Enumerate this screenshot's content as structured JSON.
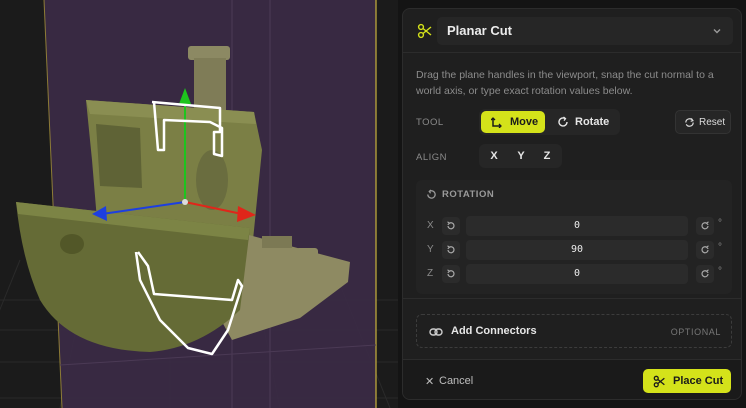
{
  "panel": {
    "title": "Planar Cut",
    "description": "Drag the plane handles in the viewport, snap the cut normal to a world axis, or type exact rotation values below.",
    "tool": {
      "label": "TOOL",
      "move_label": "Move",
      "rotate_label": "Rotate",
      "selected": "Move",
      "reset_label": "Reset"
    },
    "align": {
      "label": "ALIGN",
      "axes": [
        "X",
        "Y",
        "Z"
      ]
    },
    "rotation": {
      "title": "ROTATION",
      "rows": [
        {
          "axis": "X",
          "value": "0",
          "unit": "°"
        },
        {
          "axis": "Y",
          "value": "90",
          "unit": "°"
        },
        {
          "axis": "Z",
          "value": "0",
          "unit": "°"
        }
      ]
    },
    "connectors": {
      "label": "Add Connectors",
      "badge": "OPTIONAL"
    },
    "footer": {
      "cancel_label": "Cancel",
      "confirm_label": "Place Cut"
    }
  },
  "colors": {
    "accent": "#d4e21a",
    "cut_plane": "#3a2a44",
    "model_green": "#6b7038",
    "model_beige": "#8e8a62",
    "axis_x": "#e0261a",
    "axis_y": "#1ec41e",
    "axis_z": "#1d3fe0"
  }
}
